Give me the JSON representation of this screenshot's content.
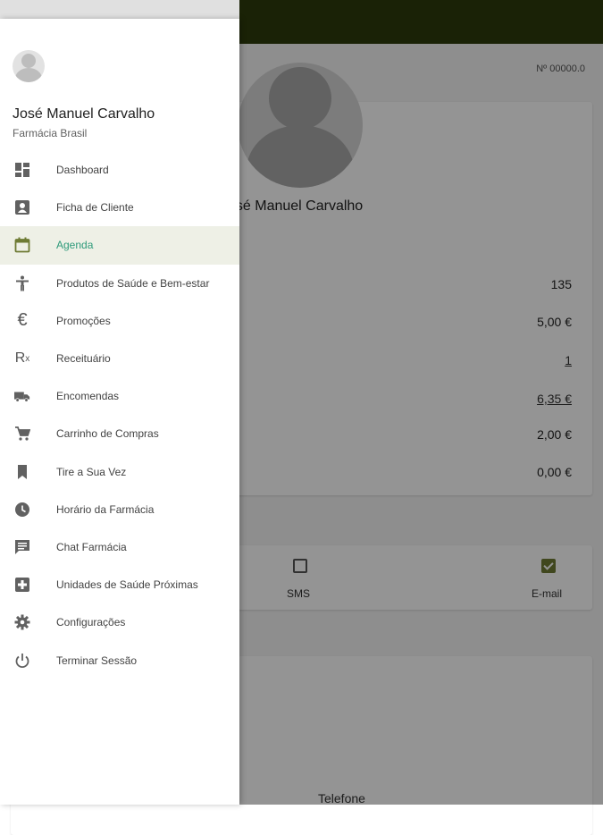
{
  "background": {
    "client_number": "Nº 00000.0",
    "profile_name": "osé Manuel Carvalho",
    "stats": [
      "135",
      "5,00 €",
      "1",
      "6,35 €",
      "2,00 €",
      "0,00 €"
    ],
    "contact_options": [
      {
        "label": "SMS",
        "checked": false
      },
      {
        "label": "E-mail",
        "checked": true
      }
    ],
    "phone_label": "Telefone"
  },
  "drawer": {
    "user_name": "José Manuel Carvalho",
    "pharmacy_name": "Farmácia Brasil",
    "items": [
      {
        "label": "Dashboard",
        "icon": "dashboard-icon",
        "active": false
      },
      {
        "label": "Ficha de Cliente",
        "icon": "contact-card-icon",
        "active": false
      },
      {
        "label": "Agenda",
        "icon": "calendar-icon",
        "active": true
      },
      {
        "label": "Produtos de Saúde e Bem-estar",
        "icon": "accessibility-icon",
        "active": false
      },
      {
        "label": "Promoções",
        "icon": "euro-icon",
        "active": false
      },
      {
        "label": "Receituário",
        "icon": "prescription-icon",
        "active": false
      },
      {
        "label": "Encomendas",
        "icon": "truck-icon",
        "active": false
      },
      {
        "label": "Carrinho de Compras",
        "icon": "cart-icon",
        "active": false
      },
      {
        "label": "Tire a Sua Vez",
        "icon": "bookmark-icon",
        "active": false
      },
      {
        "label": "Horário da Farmácia",
        "icon": "clock-icon",
        "active": false
      },
      {
        "label": "Chat Farmácia",
        "icon": "chat-icon",
        "active": false
      },
      {
        "label": "Unidades de Saúde Próximas",
        "icon": "hospital-icon",
        "active": false
      },
      {
        "label": "Configurações",
        "icon": "gear-icon",
        "active": false
      },
      {
        "label": "Terminar Sessão",
        "icon": "power-icon",
        "active": false
      }
    ]
  },
  "colors": {
    "toolbar": "#2e3b0c",
    "accent": "#6e7b34",
    "active_label": "#2e9a7a",
    "active_bg": "#eef0e6"
  }
}
